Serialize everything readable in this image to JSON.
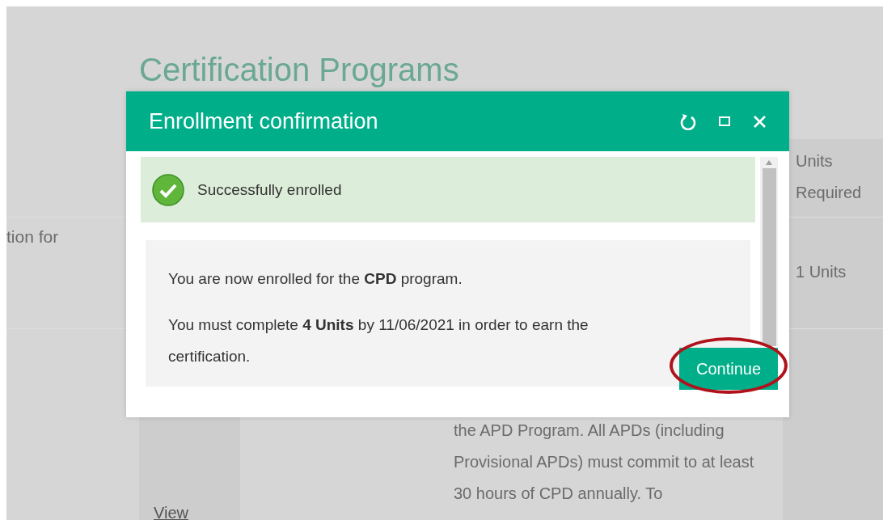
{
  "page": {
    "title": "Certification Programs",
    "side_text": "tion for",
    "table": {
      "header": {
        "column_4": "Units Required"
      },
      "rows": [
        {
          "column_1": "",
          "column_3": "",
          "column_4": "1 Units"
        },
        {
          "column_1": "View",
          "column_3": "the APD Program. All APDs (including Provisional APDs) must commit to at least 30 hours of CPD annually. To",
          "column_4": ""
        }
      ]
    }
  },
  "dialog": {
    "title": "Enrollment confirmation",
    "success": "Successfully enrolled",
    "paragraphs": [
      "You are now enrolled for the **CPD** program.",
      "You must complete **4 Units** by 11/06/2021 in order to earn the certification."
    ],
    "button": {
      "label": "Continue",
      "highlighted": true
    }
  }
}
